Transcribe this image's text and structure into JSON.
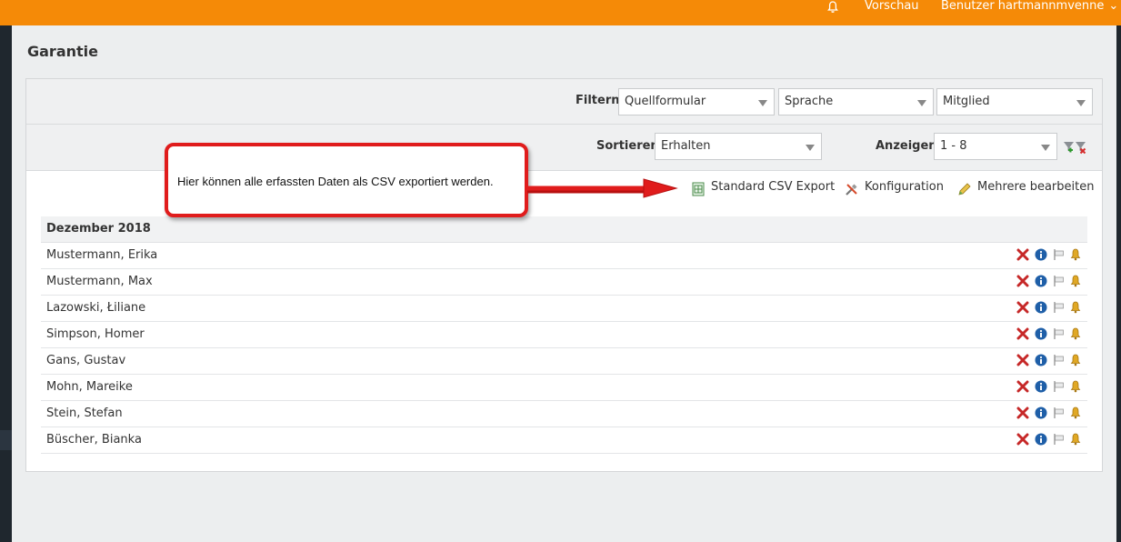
{
  "topbar": {
    "bell_icon": "bell-icon",
    "preview_label": "Vorschau",
    "user_label": "Benutzer hartmannmvenne",
    "user_chevron": "⌄",
    "bg_color": "#f58a07"
  },
  "page": {
    "title": "Garantie"
  },
  "filters": {
    "label": "Filtern:",
    "source_form": "Quellformular",
    "language": "Sprache",
    "member": "Mitglied"
  },
  "sort": {
    "label": "Sortieren:",
    "value": "Erhalten",
    "show_label": "Anzeigen:",
    "show_value": "1 - 8",
    "filter_icons": [
      "filter-add-icon",
      "filter-remove-icon"
    ]
  },
  "actions": {
    "csv_export": "Standard CSV Export",
    "configuration": "Konfiguration",
    "multi_edit": "Mehrere bearbeiten"
  },
  "callout": {
    "text": "Hier können alle erfassten Daten als CSV exportiert werden.",
    "color": "#e01c1c"
  },
  "table": {
    "group": "Dezember 2018",
    "row_icons": [
      "delete-icon",
      "info-icon",
      "flag-icon",
      "bell-icon"
    ],
    "rows": [
      "Mustermann, Erika",
      "Mustermann, Max",
      "Lazowski, Łiliane",
      "Simpson, Homer",
      "Gans, Gustav",
      "Mohn, Mareike",
      "Stein, Stefan",
      "Büscher, Bianka"
    ]
  }
}
